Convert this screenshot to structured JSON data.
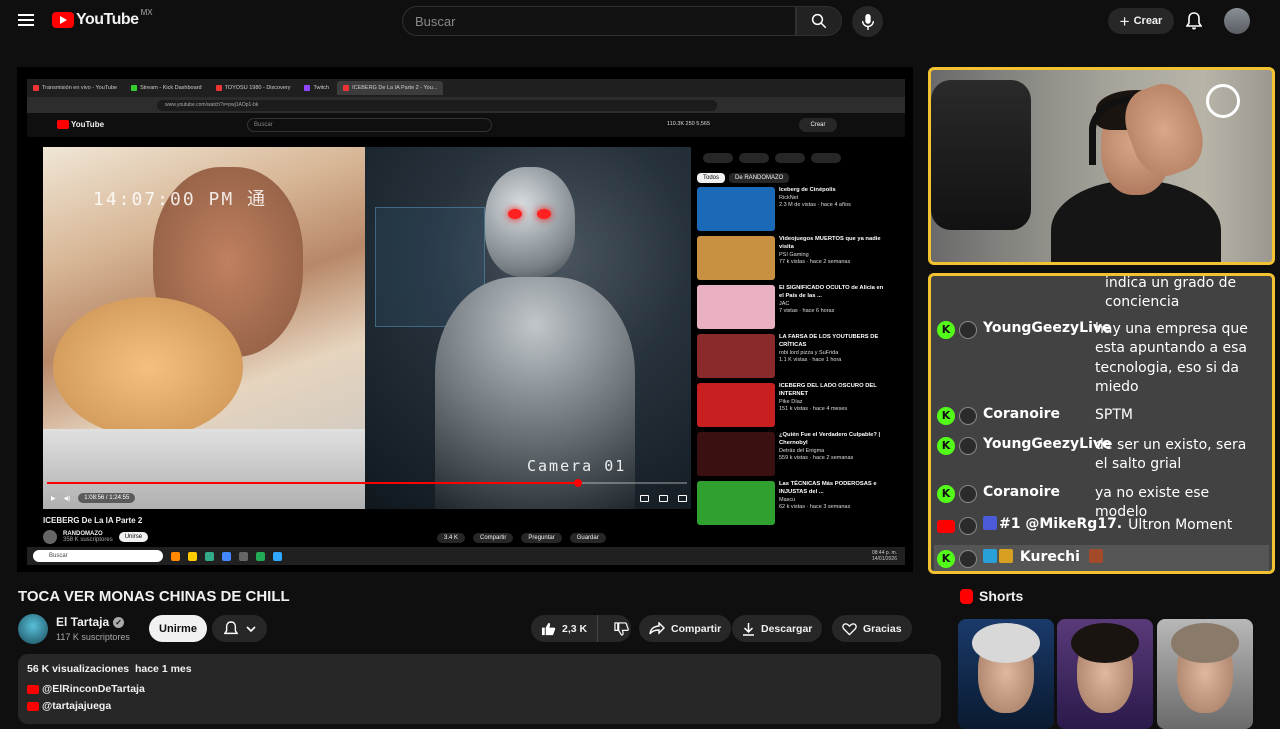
{
  "header": {
    "logo_text": "YouTube",
    "region": "MX",
    "search_placeholder": "Buscar",
    "create_label": "Crear"
  },
  "stream": {
    "browser_tabs": [
      "Transmisión en vivo - YouTube",
      "Stream - Kick Dashboard",
      "TOYOSU 1980 - Discovery",
      "Twitch",
      "ICEBERG De La IA Parte 2 - You..."
    ],
    "address": "www.youtube.com/watch?v=pwj1AOp1-bk",
    "inner_search": "Buscar",
    "inner_logo": "YouTube",
    "inner_stats": "110.3K   250   5,565",
    "inner_create": "Crear",
    "overlay_time": "14:07:00 PM 通",
    "overlay_camera": "Camera 01",
    "video_time": "1:08:56 / 1:24:55",
    "progress_fraction": 0.83,
    "inner_title": "ICEBERG De La IA Parte 2",
    "inner_channel": "RANDOMAZO",
    "inner_subs": "358 K suscriptores",
    "inner_subscribe": "Unirse",
    "inner_actions": [
      "3.4 K",
      "Compartir",
      "Preguntar",
      "Guardar"
    ],
    "filters": [
      "Todos",
      "De RANDOMAZO"
    ],
    "recs": [
      {
        "title": "Iceberg de Cinépolis",
        "channel": "RickNet",
        "meta": "2.3 M de vistas · hace 4 años",
        "color": "#1a6ab8"
      },
      {
        "title": "Videojuegos MUERTOS que ya nadie visita",
        "channel": "PSI Gaming",
        "meta": "77 k vistas · hace 2 semanas",
        "color": "#c89040"
      },
      {
        "title": "El SIGNIFICADO OCULTO de Alicia en el País de las ...",
        "channel": "JAC",
        "meta": "7 vistas · hace 6 horas",
        "color": "#e8b0c0"
      },
      {
        "title": "LA FARSA DE LOS YOUTUBERS DE CRÍTICAS",
        "channel": "robi lord pizza y SuFrida",
        "meta": "1.1 K vistas · hace 1 hora",
        "color": "#8a2a2a"
      },
      {
        "title": "ICEBERG DEL LADO OSCURO DEL INTERNET",
        "channel": "Pike Díaz",
        "meta": "151 k vistas · hace 4 meses",
        "color": "#c82020"
      },
      {
        "title": "¿Quién Fue el Verdadero Culpable? | Chernobyl",
        "channel": "Detrás del Enigma",
        "meta": "559 k vistas · hace 2 semanas",
        "color": "#3a1010"
      },
      {
        "title": "Las TÉCNICAS Más PODEROSAS e INJUSTAS del ...",
        "channel": "Mascu",
        "meta": "62 k vistas · hace 3 semanas",
        "color": "#30a030"
      }
    ],
    "taskbar_search": "Buscar",
    "clock": "08:44 p. m.\n14/01/2026"
  },
  "chat": {
    "messages": [
      {
        "platform": "kick",
        "user": "",
        "text": "indica un grado de conciencia"
      },
      {
        "platform": "kick",
        "user": "YoungGeezyLive",
        "text": "hay una empresa que esta apuntando a esa tecnologia, eso si da miedo"
      },
      {
        "platform": "kick",
        "user": "Coranoire",
        "text": "SPTM"
      },
      {
        "platform": "kick",
        "user": "YoungGeezyLive",
        "text": "de ser un existo, sera el salto grial"
      },
      {
        "platform": "kick",
        "user": "Coranoire",
        "text": "ya no existe ese modelo"
      },
      {
        "platform": "youtube",
        "user": "@MikeRg17.",
        "badge_text": "#1",
        "text": "Ultron Moment"
      },
      {
        "platform": "kick",
        "user": "Kurechi",
        "text": ""
      }
    ]
  },
  "video": {
    "title": "TOCA VER MONAS CHINAS DE CHILL",
    "channel": "El Tartaja",
    "subs": "117 K suscriptores",
    "subscribe_label": "Unirme",
    "likes": "2,3 K",
    "share": "Compartir",
    "download": "Descargar",
    "thanks": "Gracias",
    "stats": "56 K visualizaciones  hace 1 mes",
    "links": [
      "@ElRinconDeTartaja",
      "@tartajajuega"
    ]
  },
  "sidebar": {
    "shorts_title": "Shorts"
  },
  "colors": {
    "accent": "#ff0000",
    "frame_border": "#f2c230",
    "kick_green": "#53fc18"
  }
}
